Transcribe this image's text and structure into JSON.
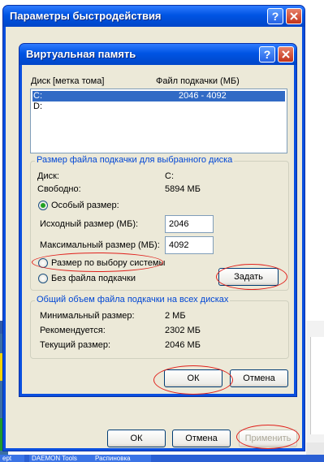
{
  "outer_window": {
    "title": "Параметры быстродействия",
    "ok_label": "ОК",
    "cancel_label": "Отмена",
    "apply_label": "Применить"
  },
  "dialog": {
    "title": "Виртуальная память",
    "list_headers": [
      "Диск [метка тома]",
      "Файл подкачки (МБ)"
    ],
    "drives": [
      {
        "drive": "C:",
        "size": "2046 - 4092",
        "selected": true
      },
      {
        "drive": "D:",
        "size": "",
        "selected": false
      }
    ],
    "selected_group": {
      "title": "Размер файла подкачки для выбранного диска",
      "disk_label": "Диск:",
      "disk_value": "C:",
      "free_label": "Свободно:",
      "free_value": "5894 МБ",
      "custom_size_label": "Особый размер:",
      "initial_label": "Исходный размер (МБ):",
      "initial_value": "2046",
      "max_label": "Максимальный размер (МБ):",
      "max_value": "4092",
      "system_managed_label": "Размер по выбору системы",
      "no_paging_label": "Без файла подкачки",
      "set_button": "Задать"
    },
    "total_group": {
      "title": "Общий объем файла подкачки на всех дисках",
      "min_label": "Минимальный размер:",
      "min_value": "2 МБ",
      "recommended_label": "Рекомендуется:",
      "recommended_value": "2302 МБ",
      "current_label": "Текущий размер:",
      "current_value": "2046 МБ"
    },
    "ok_label": "ОК",
    "cancel_label": "Отмена"
  },
  "taskbar": {
    "items": [
      "ept",
      "DAEMON Tools",
      "Распиновка"
    ]
  },
  "colors": {
    "titlebar": "#0054e3",
    "client": "#ece9d8",
    "group_title": "#0046d5",
    "highlight_ellipse": "#e0201b",
    "selection": "#316ac5"
  }
}
